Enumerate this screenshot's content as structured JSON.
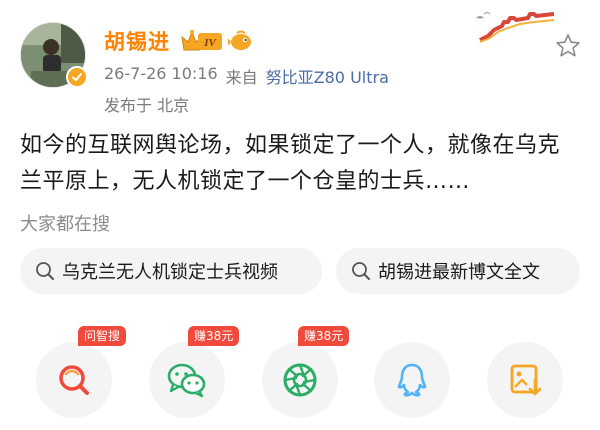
{
  "author": {
    "name": "胡锡进",
    "vip_level": "IV"
  },
  "meta": {
    "time": "26-7-26 10:16",
    "source_prefix": "来自",
    "device": "努比亚Z80 Ultra",
    "location": "发布于 北京"
  },
  "post": {
    "text": "如今的互联网舆论场，如果锁定了一个人，就像在乌克兰平原上，无人机锁定了一个仓皇的士兵……"
  },
  "search": {
    "title": "大家都在搜",
    "chips": [
      {
        "label": "乌克兰无人机锁定士兵视频",
        "icon": "search-icon"
      },
      {
        "label": "胡锡进最新博文全文",
        "icon": "search-icon"
      }
    ]
  },
  "share": {
    "buttons": [
      {
        "icon": "zhisou-icon",
        "tag": "问智搜"
      },
      {
        "icon": "wechat-icon",
        "tag": "赚38元"
      },
      {
        "icon": "moments-icon",
        "tag": "赚38元"
      },
      {
        "icon": "qq-icon",
        "tag": ""
      },
      {
        "icon": "save-image-icon",
        "tag": ""
      }
    ]
  },
  "colors": {
    "author": "#ff8200",
    "device_link": "#4a6da7",
    "tag": "#f04a3c",
    "wechat": "#2aae67",
    "qq": "#4fb3f6",
    "zhisou": "#f04a3c",
    "save": "#f5a623"
  }
}
